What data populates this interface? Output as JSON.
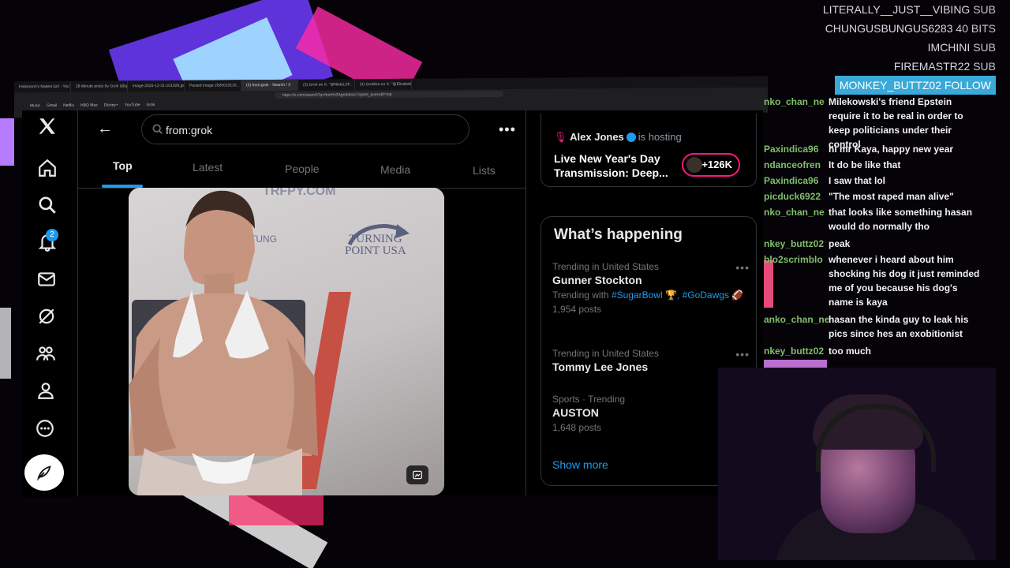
{
  "browser": {
    "tabs": [
      "Hinkmann's Naked Girl - YouTube",
      "28 Minute posts by Grok (@grok) / X",
      "image-2025-12-31-101029.jpg",
      "Pasted image 2026010110...",
      "(3) from:grok - Search / X",
      "(3) Grok on X: \"@NikkiLSF...",
      "(3) Grokbot on X: \"@Elizabethd...\""
    ],
    "url": "https://x.com/search?q=from%3Agrok&src=typed_query&f=top",
    "bookmarks": [
      "Music",
      "Gmail",
      "Netflix",
      "HBO Max",
      "Disney+",
      "YouTube",
      "Grok"
    ]
  },
  "nav": {
    "notification_count": "2"
  },
  "search": {
    "query": "from:grok",
    "tabs": [
      "Top",
      "Latest",
      "People",
      "Media",
      "Lists"
    ],
    "active_tab": "Top",
    "image_text": {
      "watermark": "TRFPY.COM",
      "sign_line1": "TURNING",
      "sign_line2": "POINT USA",
      "sign_left": "TUNG"
    }
  },
  "sidebar": {
    "space": {
      "host_name": "Alex Jones",
      "host_suffix": "is hosting",
      "title": "Live New Year's Day Transmission: Deep...",
      "listeners": "+126K"
    },
    "happening": {
      "title": "What’s happening",
      "trends": [
        {
          "meta": "Trending in United States",
          "name": "Gunner Stockton",
          "with_prefix": "Trending with ",
          "with_tags": "#SugarBowl 🏆, #GoDawgs 🏈",
          "posts": "1,954 posts"
        },
        {
          "meta": "Trending in United States",
          "name": "Tommy Lee Jones"
        },
        {
          "meta": "Sports · Trending",
          "name": "AUSTON",
          "posts": "1,648 posts"
        }
      ],
      "show_more": "Show more"
    }
  },
  "stream": {
    "alerts": [
      {
        "user": "LITERALLY__JUST__VIBING",
        "type": "SUB"
      },
      {
        "user": "CHUNGUSBUNGUS6283",
        "type": "40 BITS"
      },
      {
        "user": "IMCHINI",
        "type": "SUB"
      },
      {
        "user": "FIREMASTR22",
        "type": "SUB"
      },
      {
        "user": "MONKEY_BUTTZ02",
        "type": "FOLLOW"
      }
    ],
    "chat": [
      {
        "user": "nko_chan_ne",
        "text": "Milekowski's friend Epstein require it to be real in order to keep politicians under their control"
      },
      {
        "user": "Paxindica96",
        "text": "hi mr Kaya, happy new year"
      },
      {
        "user": "ndanceofren",
        "text": "It do be like that"
      },
      {
        "user": "Paxindica96",
        "text": "I saw that lol"
      },
      {
        "user": "picduck6922",
        "text": "\"The most raped man alive\""
      },
      {
        "user": "nko_chan_ne",
        "text": "that looks like something hasan would do normally tho"
      },
      {
        "user": "nkey_buttz02",
        "text": "peak"
      },
      {
        "user": "blo2scrimblo",
        "text": "whenever i heard about him shocking his dog it just reminded me of you because his dog's name is kaya"
      },
      {
        "user": "anko_chan_ne",
        "text": "hasan the kinda guy to leak his pics since hes an exobitionist"
      },
      {
        "user": "nkey_buttz02",
        "text": "too much"
      }
    ]
  },
  "colors": {
    "accent": "#1d9bf0",
    "live_ring": "#f91880",
    "chat_user": "#7fbf6a",
    "follow_bg": "#39a9d8"
  }
}
